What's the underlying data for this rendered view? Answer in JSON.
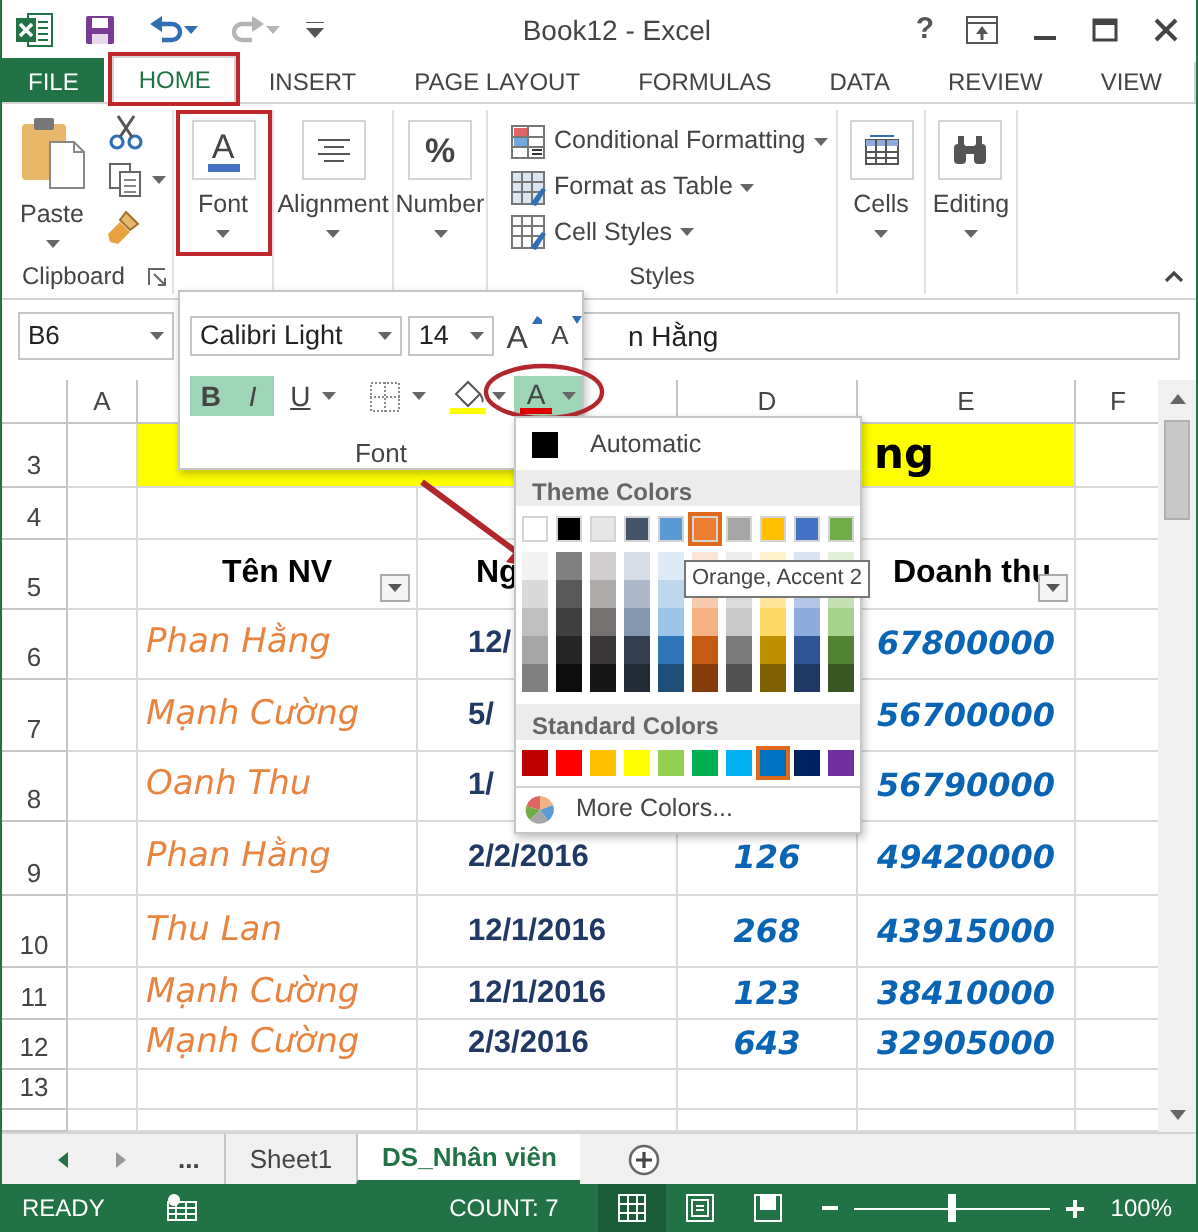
{
  "window": {
    "title": "Book12 - Excel",
    "help": "?"
  },
  "quick_access": [
    {
      "kind": "save",
      "disabled": false
    },
    {
      "kind": "undo",
      "disabled": false
    },
    {
      "kind": "redo",
      "disabled": true
    }
  ],
  "ribbon_tabs": [
    {
      "label": "FILE",
      "kind": "file",
      "selected": false
    },
    {
      "label": "HOME",
      "kind": "tab",
      "selected": true
    },
    {
      "label": "INSERT",
      "kind": "tab",
      "selected": false
    },
    {
      "label": "PAGE LAYOUT",
      "kind": "tab",
      "selected": false
    },
    {
      "label": "FORMULAS",
      "kind": "tab",
      "selected": false
    },
    {
      "label": "DATA",
      "kind": "tab",
      "selected": false
    },
    {
      "label": "REVIEW",
      "kind": "tab",
      "selected": false
    },
    {
      "label": "VIEW",
      "kind": "tab",
      "selected": false
    }
  ],
  "ribbon": {
    "clipboard": {
      "paste": "Paste",
      "label": "Clipboard"
    },
    "groups": [
      {
        "kind": "font",
        "label": "Font",
        "glyph": "A"
      },
      {
        "kind": "alignment",
        "label": "Alignment"
      },
      {
        "kind": "number",
        "label": "Number",
        "glyph": "%"
      }
    ],
    "styles": {
      "items": [
        {
          "kind": "conditional",
          "label": "Conditional Formatting"
        },
        {
          "kind": "table",
          "label": "Format as Table"
        },
        {
          "kind": "cell_styles",
          "label": "Cell Styles"
        }
      ],
      "label": "Styles"
    },
    "groups_right": [
      {
        "kind": "cells",
        "label": "Cells"
      },
      {
        "kind": "editing",
        "label": "Editing"
      }
    ]
  },
  "name_box": "B6",
  "formula_bar": {
    "value": "n Hằng"
  },
  "font_panel": {
    "font_name": "Calibri Light",
    "font_size": "14",
    "grow": "A",
    "shrink": "A",
    "bold": {
      "label": "B",
      "on": true
    },
    "italic": {
      "label": "I",
      "on": true
    },
    "underline": {
      "label": "U",
      "on": false
    },
    "font_color": {
      "label": "A",
      "expanded": true
    },
    "label": "Font"
  },
  "color_menu": {
    "automatic": "Automatic",
    "theme_header": "Theme Colors",
    "theme_colors": [
      {
        "color": "#ffffff",
        "selected": false,
        "shades": [
          {
            "color": "#f2f2f2"
          },
          {
            "color": "#d9d9d9"
          },
          {
            "color": "#bfbfbf"
          },
          {
            "color": "#a6a6a6"
          },
          {
            "color": "#808080"
          }
        ]
      },
      {
        "color": "#000000",
        "selected": false,
        "shades": [
          {
            "color": "#808080"
          },
          {
            "color": "#595959"
          },
          {
            "color": "#404040"
          },
          {
            "color": "#262626"
          },
          {
            "color": "#0d0d0d"
          }
        ]
      },
      {
        "color": "#e7e6e6",
        "selected": false,
        "shades": [
          {
            "color": "#d0cece"
          },
          {
            "color": "#aeabab"
          },
          {
            "color": "#757171"
          },
          {
            "color": "#3a3838"
          },
          {
            "color": "#171616"
          }
        ]
      },
      {
        "color": "#44546a",
        "selected": false,
        "shades": [
          {
            "color": "#d6dce5"
          },
          {
            "color": "#adb9ca"
          },
          {
            "color": "#8497b0"
          },
          {
            "color": "#333f50"
          },
          {
            "color": "#222a35"
          }
        ]
      },
      {
        "color": "#5b9bd5",
        "selected": false,
        "shades": [
          {
            "color": "#deebf7"
          },
          {
            "color": "#bdd7ee"
          },
          {
            "color": "#9dc3e6"
          },
          {
            "color": "#2e75b6"
          },
          {
            "color": "#1f4e79"
          }
        ]
      },
      {
        "color": "#ed7d31",
        "selected": true,
        "shades": [
          {
            "color": "#fbe5d6"
          },
          {
            "color": "#f8cbad"
          },
          {
            "color": "#f4b183"
          },
          {
            "color": "#c55a11"
          },
          {
            "color": "#843c0c"
          }
        ]
      },
      {
        "color": "#a5a5a5",
        "selected": false,
        "shades": [
          {
            "color": "#ededed"
          },
          {
            "color": "#dbdbdb"
          },
          {
            "color": "#c9c9c9"
          },
          {
            "color": "#7b7b7b"
          },
          {
            "color": "#525252"
          }
        ]
      },
      {
        "color": "#ffc000",
        "selected": false,
        "shades": [
          {
            "color": "#fff2cc"
          },
          {
            "color": "#ffe699"
          },
          {
            "color": "#ffd966"
          },
          {
            "color": "#bf9000"
          },
          {
            "color": "#7f6000"
          }
        ]
      },
      {
        "color": "#4472c4",
        "selected": false,
        "shades": [
          {
            "color": "#dae3f3"
          },
          {
            "color": "#b4c7e7"
          },
          {
            "color": "#8faadc"
          },
          {
            "color": "#2f5597"
          },
          {
            "color": "#203864"
          }
        ]
      },
      {
        "color": "#70ad47",
        "selected": false,
        "shades": [
          {
            "color": "#e2f0d9"
          },
          {
            "color": "#c5e0b4"
          },
          {
            "color": "#a9d18e"
          },
          {
            "color": "#548235"
          },
          {
            "color": "#385723"
          }
        ]
      }
    ],
    "standard_header": "Standard Colors",
    "standard_colors": [
      {
        "color": "#c00000",
        "selected": false
      },
      {
        "color": "#ff0000",
        "selected": false
      },
      {
        "color": "#ffc000",
        "selected": false
      },
      {
        "color": "#ffff00",
        "selected": false
      },
      {
        "color": "#92d050",
        "selected": false
      },
      {
        "color": "#00b050",
        "selected": false
      },
      {
        "color": "#00b0f0",
        "selected": false
      },
      {
        "color": "#0070c0",
        "selected": true
      },
      {
        "color": "#002060",
        "selected": false
      },
      {
        "color": "#7030a0",
        "selected": false
      }
    ],
    "more": "More Colors...",
    "tooltip": "Orange, Accent 2"
  },
  "sheet": {
    "columns": [
      {
        "label": "A"
      },
      {},
      {},
      {
        "label": "D"
      },
      {
        "label": "E"
      },
      {
        "label": "F"
      }
    ],
    "rows": [
      {
        "kind": "title",
        "number": "3",
        "title": "ng"
      },
      {
        "kind": "blank",
        "number": "4"
      },
      {
        "kind": "header",
        "number": "5",
        "name": "Tên NV",
        "date": "Ng",
        "revenue": "Doanh thu"
      },
      {
        "kind": "data",
        "number": "6",
        "name": "Phan Hằng",
        "date": "12/",
        "revenue": "67800000"
      },
      {
        "kind": "data",
        "number": "7",
        "name": "Mạnh Cường",
        "date": "5/",
        "revenue": "56700000"
      },
      {
        "kind": "data",
        "number": "8",
        "name": "Oanh Thu",
        "date": "1/",
        "revenue": "56790000"
      },
      {
        "kind": "data",
        "number": "9",
        "name": "Phan Hằng",
        "date": "2/2/2016",
        "qty": "126",
        "revenue": "49420000"
      },
      {
        "kind": "data",
        "number": "10",
        "name": "Thu Lan",
        "date": "12/1/2016",
        "qty": "268",
        "revenue": "43915000"
      },
      {
        "kind": "data",
        "number": "11",
        "name": "Mạnh Cường",
        "date": "12/1/2016",
        "qty": "123",
        "revenue": "38410000"
      },
      {
        "kind": "data",
        "number": "12",
        "name": "Mạnh Cường",
        "date": "2/3/2016",
        "qty": "643",
        "revenue": "32905000"
      },
      {
        "kind": "blank",
        "number": "13"
      },
      {
        "kind": "blank"
      }
    ]
  },
  "sheet_tabs": {
    "more": "...",
    "tabs": [
      {
        "label": "Sheet1",
        "selected": false
      },
      {
        "label": "DS_Nhân viên",
        "selected": true
      }
    ]
  },
  "status_bar": {
    "mode": "READY",
    "count": "COUNT: 7",
    "views": [
      {
        "kind": "normal",
        "selected": true
      },
      {
        "kind": "page_layout",
        "selected": false
      },
      {
        "kind": "page_break",
        "selected": false
      }
    ],
    "zoom": {
      "level": 0.5,
      "reading": "100%"
    }
  }
}
